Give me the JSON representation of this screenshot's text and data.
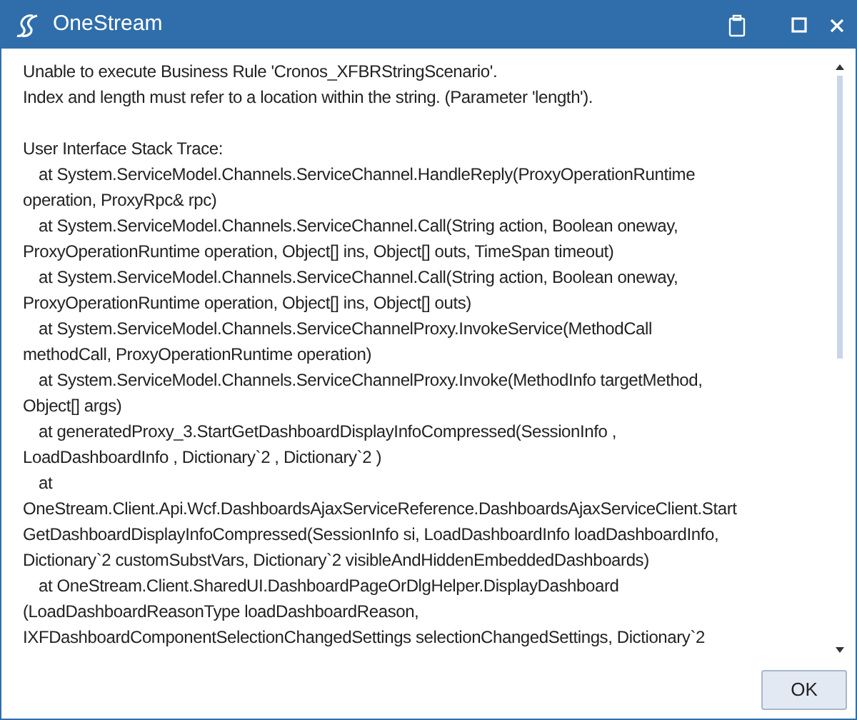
{
  "window": {
    "title": "OneStream"
  },
  "message_lines": [
    "Unable to execute Business Rule 'Cronos_XFBRStringScenario'.",
    "Index and length must refer to a location within the string. (Parameter 'length')."
  ],
  "stack_trace": {
    "title": "User Interface Stack Trace:",
    "lines": [
      {
        "text": "at System.ServiceModel.Channels.ServiceChannel.HandleReply(ProxyOperationRuntime",
        "indent": true
      },
      {
        "text": "operation, ProxyRpc& rpc)",
        "indent": false
      },
      {
        "text": "at System.ServiceModel.Channels.ServiceChannel.Call(String action, Boolean oneway,",
        "indent": true
      },
      {
        "text": "ProxyOperationRuntime operation, Object[] ins, Object[] outs, TimeSpan timeout)",
        "indent": false
      },
      {
        "text": "at System.ServiceModel.Channels.ServiceChannel.Call(String action, Boolean oneway,",
        "indent": true
      },
      {
        "text": "ProxyOperationRuntime operation, Object[] ins, Object[] outs)",
        "indent": false
      },
      {
        "text": "at System.ServiceModel.Channels.ServiceChannelProxy.InvokeService(MethodCall",
        "indent": true
      },
      {
        "text": "methodCall, ProxyOperationRuntime operation)",
        "indent": false
      },
      {
        "text": "at System.ServiceModel.Channels.ServiceChannelProxy.Invoke(MethodInfo targetMethod,",
        "indent": true
      },
      {
        "text": "Object[] args)",
        "indent": false
      },
      {
        "text": "at generatedProxy_3.StartGetDashboardDisplayInfoCompressed(SessionInfo ,",
        "indent": true
      },
      {
        "text": "LoadDashboardInfo , Dictionary`2 , Dictionary`2 )",
        "indent": false
      },
      {
        "text": "at",
        "indent": true
      },
      {
        "text": "OneStream.Client.Api.Wcf.DashboardsAjaxServiceReference.DashboardsAjaxServiceClient.Start",
        "indent": false
      },
      {
        "text": "GetDashboardDisplayInfoCompressed(SessionInfo si, LoadDashboardInfo loadDashboardInfo,",
        "indent": false
      },
      {
        "text": "Dictionary`2 customSubstVars, Dictionary`2 visibleAndHiddenEmbeddedDashboards)",
        "indent": false
      },
      {
        "text": "at OneStream.Client.SharedUI.DashboardPageOrDlgHelper.DisplayDashboard",
        "indent": true
      },
      {
        "text": "(LoadDashboardReasonType loadDashboardReason,",
        "indent": false
      },
      {
        "text": "IXFDashboardComponentSelectionChangedSettings selectionChangedSettings, Dictionary`2",
        "indent": false
      }
    ]
  },
  "buttons": [
    {
      "label": "OK"
    }
  ]
}
